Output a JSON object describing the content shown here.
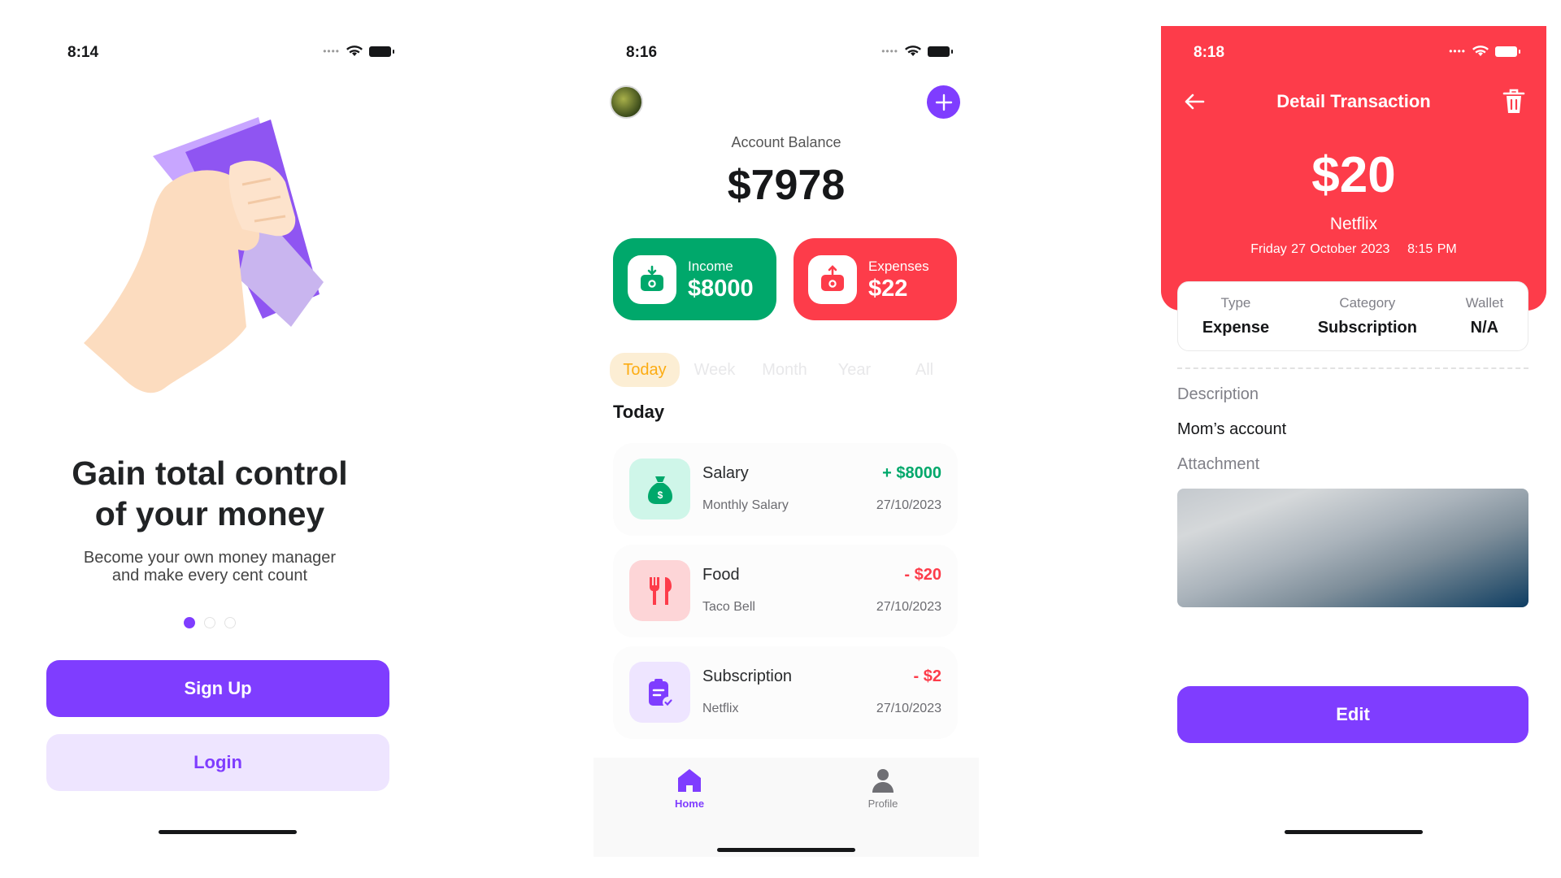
{
  "screens": {
    "onboarding": {
      "time": "8:14",
      "title_line1": "Gain total control",
      "title_line2": "of your money",
      "subtitle_line1": "Become your own money manager",
      "subtitle_line2": "and make every cent count",
      "signup_label": "Sign Up",
      "login_label": "Login"
    },
    "home": {
      "time": "8:16",
      "balance_label": "Account Balance",
      "balance_value": "$7978",
      "income": {
        "label": "Income",
        "value": "$8000"
      },
      "expenses": {
        "label": "Expenses",
        "value": "$22"
      },
      "tabs": [
        "Today",
        "Week",
        "Month",
        "Year",
        "All"
      ],
      "active_tab": "Today",
      "section_title": "Today",
      "transactions": [
        {
          "name": "Salary",
          "desc": "Monthly Salary",
          "amount": "+ $8000",
          "date": "27/10/2023",
          "icon": "money-bag-icon",
          "type": "income"
        },
        {
          "name": "Food",
          "desc": "Taco Bell",
          "amount": "- $20",
          "date": "27/10/2023",
          "icon": "restaurant-icon",
          "type": "expense"
        },
        {
          "name": "Subscription",
          "desc": "Netflix",
          "amount": "- $2",
          "date": "27/10/2023",
          "icon": "recurring-bill-icon",
          "type": "expense"
        }
      ],
      "nav": {
        "home": "Home",
        "profile": "Profile"
      }
    },
    "detail": {
      "time": "8:18",
      "title": "Detail Transaction",
      "amount": "$20",
      "merchant": "Netflix",
      "date": "Friday 27 October 2023",
      "clock": "8:15 PM",
      "info": [
        {
          "key": "Type",
          "value": "Expense"
        },
        {
          "key": "Category",
          "value": "Subscription"
        },
        {
          "key": "Wallet",
          "value": "N/A"
        }
      ],
      "description_label": "Description",
      "description_value": "Mom’s account",
      "attachment_label": "Attachment",
      "edit_label": "Edit"
    }
  },
  "colors": {
    "violet": "#7f3dff",
    "violet_light": "#eee5ff",
    "green": "#00a86b",
    "red": "#fd3c4a",
    "yellow": "#fcac12"
  }
}
